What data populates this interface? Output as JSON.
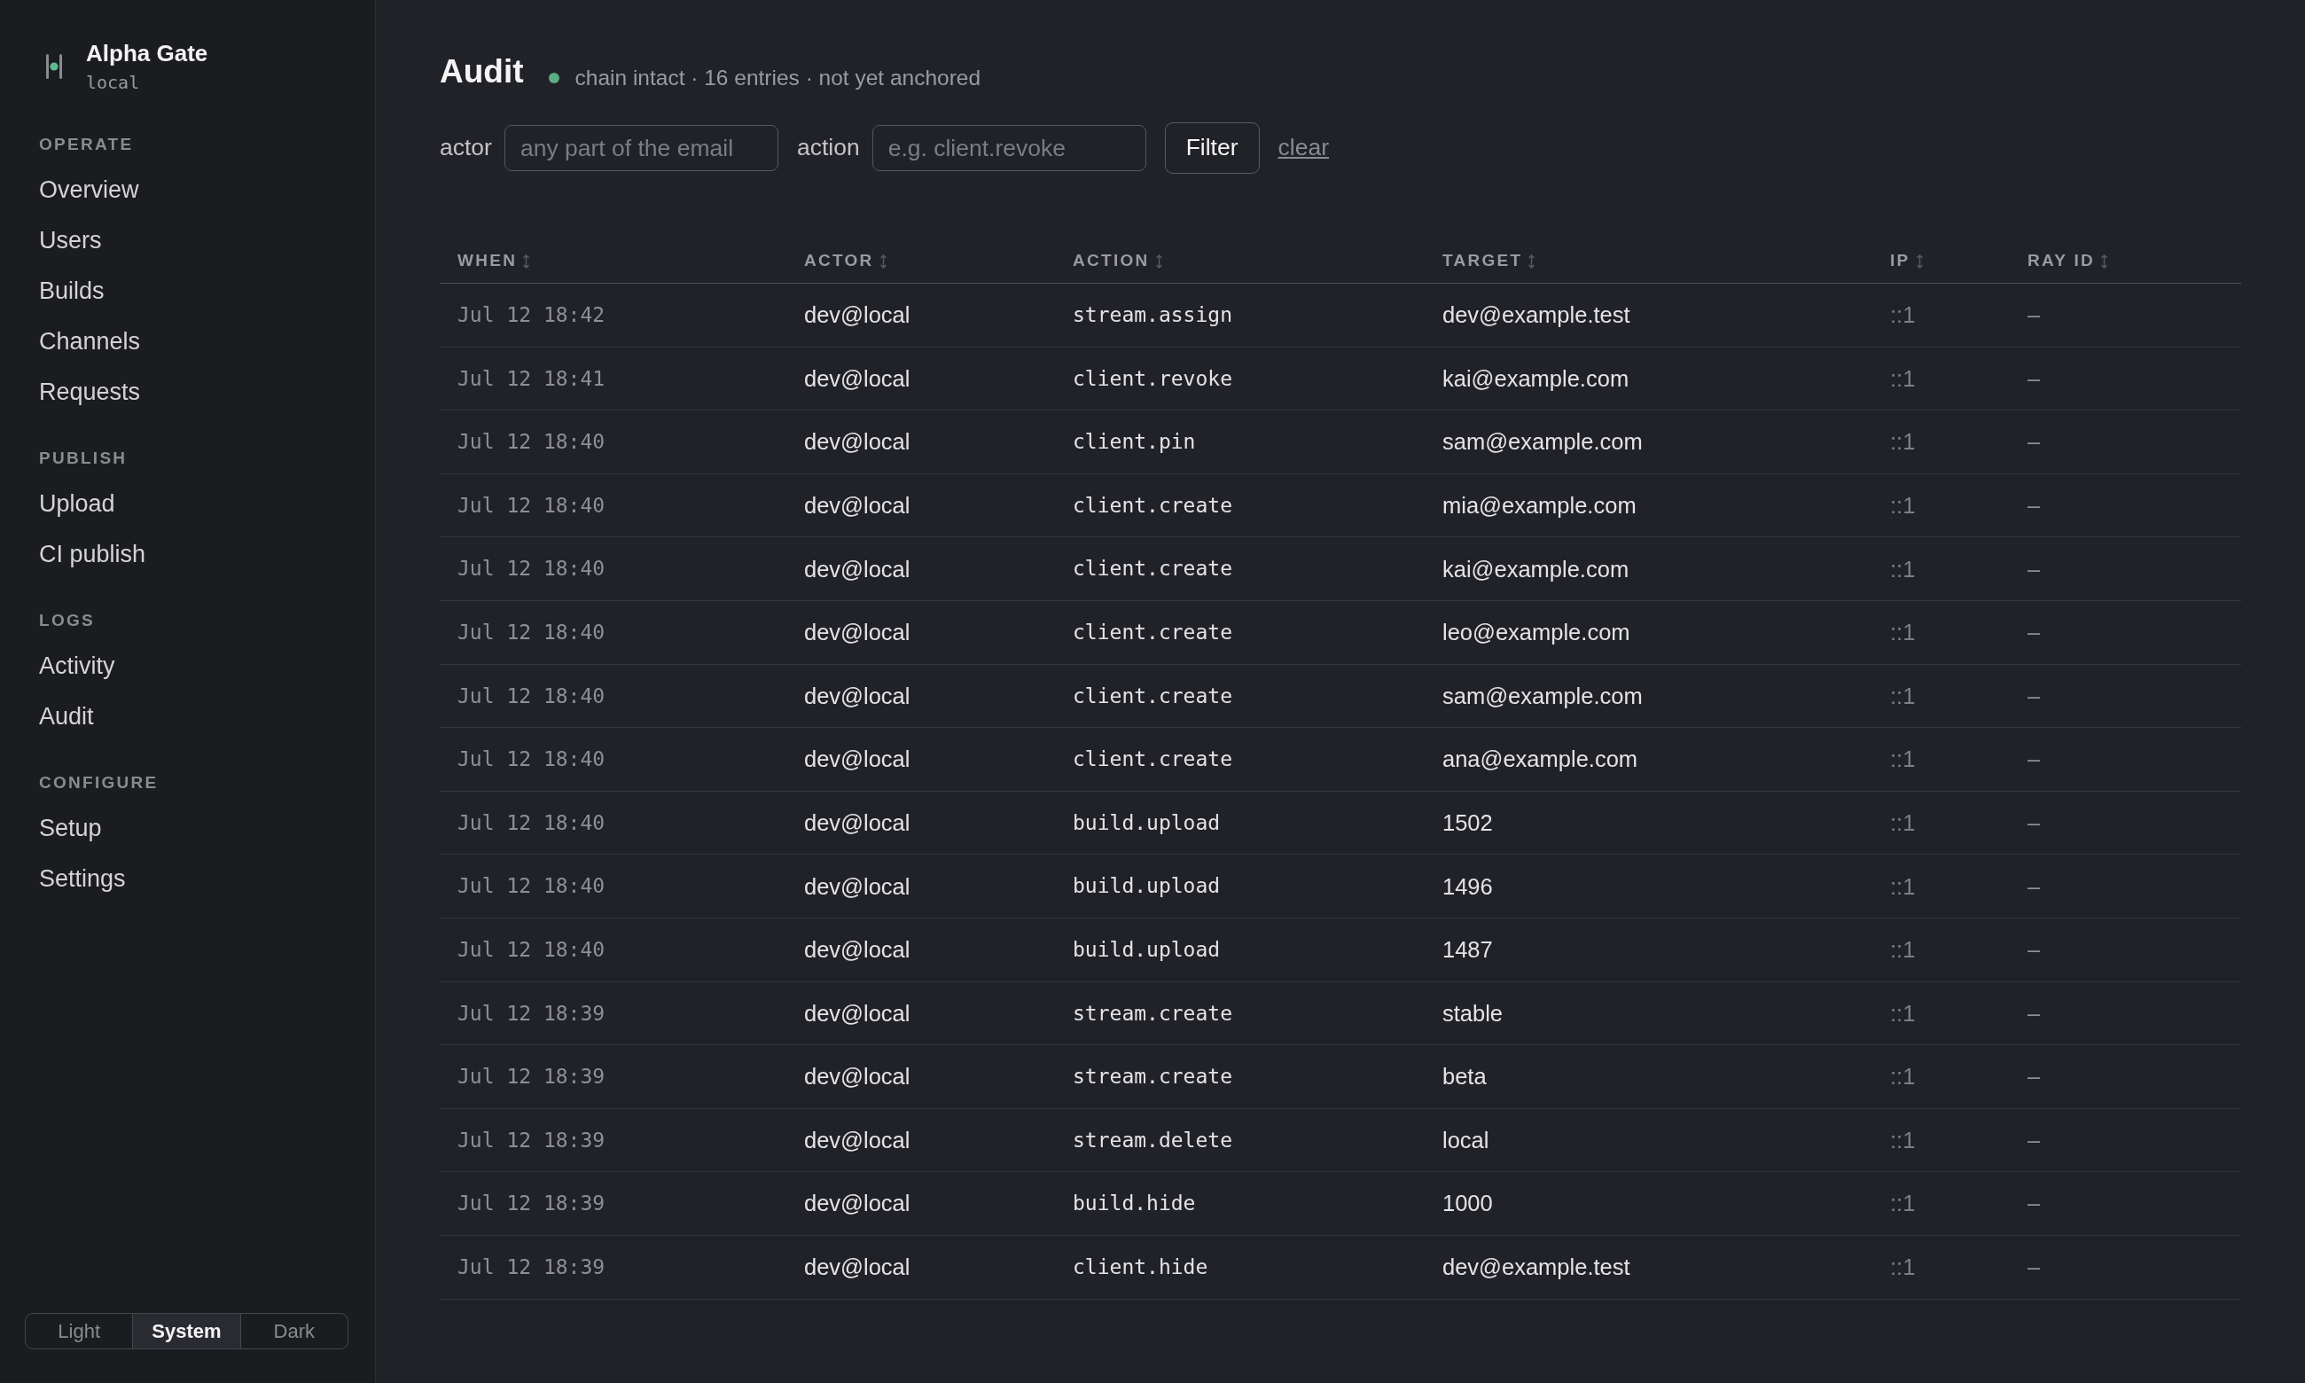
{
  "sidebar": {
    "brand": {
      "name": "Alpha Gate",
      "environment": "local"
    },
    "sections": [
      {
        "title": "OPERATE",
        "items": [
          {
            "label": "Overview"
          },
          {
            "label": "Users"
          },
          {
            "label": "Builds"
          },
          {
            "label": "Channels"
          },
          {
            "label": "Requests"
          }
        ]
      },
      {
        "title": "PUBLISH",
        "items": [
          {
            "label": "Upload"
          },
          {
            "label": "CI publish"
          }
        ]
      },
      {
        "title": "LOGS",
        "items": [
          {
            "label": "Activity"
          },
          {
            "label": "Audit"
          }
        ]
      },
      {
        "title": "CONFIGURE",
        "items": [
          {
            "label": "Setup"
          },
          {
            "label": "Settings"
          }
        ]
      }
    ],
    "theme_options": [
      {
        "label": "Light",
        "selected": false
      },
      {
        "label": "System",
        "selected": true
      },
      {
        "label": "Dark",
        "selected": false
      }
    ]
  },
  "header": {
    "title": "Audit",
    "status": "chain intact · 16 entries · not yet anchored"
  },
  "filters": {
    "fields": [
      {
        "label": "actor",
        "placeholder": "any part of the email"
      },
      {
        "label": "action",
        "placeholder": "e.g. client.revoke"
      }
    ],
    "submit": "Filter",
    "clear": "clear"
  },
  "table": {
    "columns": [
      "WHEN",
      "ACTOR",
      "ACTION",
      "TARGET",
      "IP",
      "RAY ID"
    ],
    "rows": [
      {
        "when": "Jul 12 18:42",
        "actor": "dev@local",
        "action": "stream.assign",
        "target": "dev@example.test",
        "ip": "::1",
        "ray_id": "–"
      },
      {
        "when": "Jul 12 18:41",
        "actor": "dev@local",
        "action": "client.revoke",
        "target": "kai@example.com",
        "ip": "::1",
        "ray_id": "–"
      },
      {
        "when": "Jul 12 18:40",
        "actor": "dev@local",
        "action": "client.pin",
        "target": "sam@example.com",
        "ip": "::1",
        "ray_id": "–"
      },
      {
        "when": "Jul 12 18:40",
        "actor": "dev@local",
        "action": "client.create",
        "target": "mia@example.com",
        "ip": "::1",
        "ray_id": "–"
      },
      {
        "when": "Jul 12 18:40",
        "actor": "dev@local",
        "action": "client.create",
        "target": "kai@example.com",
        "ip": "::1",
        "ray_id": "–"
      },
      {
        "when": "Jul 12 18:40",
        "actor": "dev@local",
        "action": "client.create",
        "target": "leo@example.com",
        "ip": "::1",
        "ray_id": "–"
      },
      {
        "when": "Jul 12 18:40",
        "actor": "dev@local",
        "action": "client.create",
        "target": "sam@example.com",
        "ip": "::1",
        "ray_id": "–"
      },
      {
        "when": "Jul 12 18:40",
        "actor": "dev@local",
        "action": "client.create",
        "target": "ana@example.com",
        "ip": "::1",
        "ray_id": "–"
      },
      {
        "when": "Jul 12 18:40",
        "actor": "dev@local",
        "action": "build.upload",
        "target": "1502",
        "ip": "::1",
        "ray_id": "–"
      },
      {
        "when": "Jul 12 18:40",
        "actor": "dev@local",
        "action": "build.upload",
        "target": "1496",
        "ip": "::1",
        "ray_id": "–"
      },
      {
        "when": "Jul 12 18:40",
        "actor": "dev@local",
        "action": "build.upload",
        "target": "1487",
        "ip": "::1",
        "ray_id": "–"
      },
      {
        "when": "Jul 12 18:39",
        "actor": "dev@local",
        "action": "stream.create",
        "target": "stable",
        "ip": "::1",
        "ray_id": "–"
      },
      {
        "when": "Jul 12 18:39",
        "actor": "dev@local",
        "action": "stream.create",
        "target": "beta",
        "ip": "::1",
        "ray_id": "–"
      },
      {
        "when": "Jul 12 18:39",
        "actor": "dev@local",
        "action": "stream.delete",
        "target": "local",
        "ip": "::1",
        "ray_id": "–"
      },
      {
        "when": "Jul 12 18:39",
        "actor": "dev@local",
        "action": "build.hide",
        "target": "1000",
        "ip": "::1",
        "ray_id": "–"
      },
      {
        "when": "Jul 12 18:39",
        "actor": "dev@local",
        "action": "client.hide",
        "target": "dev@example.test",
        "ip": "::1",
        "ray_id": "–"
      }
    ]
  }
}
